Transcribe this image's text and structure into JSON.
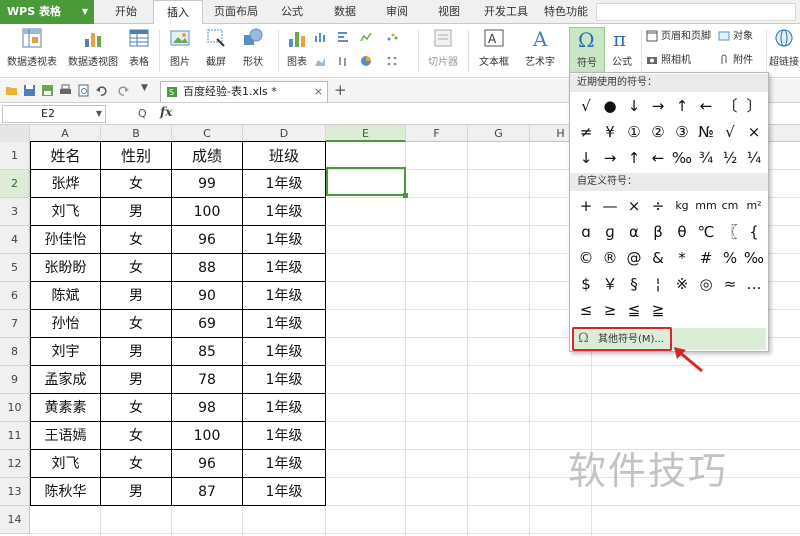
{
  "app": {
    "name": "WPS 表格"
  },
  "menu": {
    "tabs": [
      "开始",
      "插入",
      "页面布局",
      "公式",
      "数据",
      "审阅",
      "视图",
      "开发工具",
      "特色功能"
    ],
    "active": "插入"
  },
  "ribbon": {
    "pivot_table": "数据透视表",
    "pivot_chart": "数据透视图",
    "table": "表格",
    "picture": "图片",
    "screenshot": "截屏",
    "shape": "形状",
    "chart": "图表",
    "slicer": "切片器",
    "textbox": "文本框",
    "wordart": "艺术字",
    "symbol": "符号",
    "formula": "公式",
    "header_footer": "页眉和页脚",
    "object": "对象",
    "camera": "照相机",
    "attachment": "附件",
    "hyperlink": "超链接"
  },
  "document": {
    "tab_title": "百度经验-表1.xls *"
  },
  "formula_bar": {
    "cell_ref": "E2",
    "fx_label": "fx"
  },
  "sheet": {
    "columns": [
      "A",
      "B",
      "C",
      "D",
      "E",
      "F",
      "G",
      "H"
    ],
    "rows": [
      "1",
      "2",
      "3",
      "4",
      "5",
      "6",
      "7",
      "8",
      "9",
      "10",
      "11",
      "12",
      "13",
      "14"
    ],
    "header": [
      "姓名",
      "性别",
      "成绩",
      "班级"
    ],
    "data": [
      [
        "张烨",
        "女",
        "99",
        "1年级"
      ],
      [
        "刘飞",
        "男",
        "100",
        "1年级"
      ],
      [
        "孙佳怡",
        "女",
        "96",
        "1年级"
      ],
      [
        "张盼盼",
        "女",
        "88",
        "1年级"
      ],
      [
        "陈斌",
        "男",
        "90",
        "1年级"
      ],
      [
        "孙怡",
        "女",
        "69",
        "1年级"
      ],
      [
        "刘宇",
        "男",
        "85",
        "1年级"
      ],
      [
        "孟家成",
        "男",
        "78",
        "1年级"
      ],
      [
        "黄素素",
        "女",
        "98",
        "1年级"
      ],
      [
        "王语嫣",
        "女",
        "100",
        "1年级"
      ],
      [
        "刘飞",
        "女",
        "96",
        "1年级"
      ],
      [
        "陈秋华",
        "男",
        "87",
        "1年级"
      ]
    ]
  },
  "symbol_panel": {
    "recent_title": "近期使用的符号：",
    "recent": [
      "√",
      "●",
      "↓",
      "→",
      "↑",
      "←",
      "〔",
      "〕",
      "≠",
      "¥",
      "①",
      "②",
      "③",
      "№",
      "√",
      "×",
      "↓",
      "→",
      "↑",
      "←",
      "‰",
      "¾",
      "½",
      "¼"
    ],
    "custom_title": "自定义符号：",
    "custom": [
      "+",
      "—",
      "×",
      "÷",
      "kg",
      "mm",
      "cm",
      "m²",
      "ɑ",
      "ɡ",
      "α",
      "β",
      "θ",
      "℃",
      "〖",
      "{",
      "©",
      "®",
      "@",
      "&",
      "*",
      "#",
      "%",
      "‰",
      "$",
      "￥",
      "§",
      "¦",
      "※",
      "◎",
      "≈",
      "…",
      "≤",
      "≥",
      "≦",
      "≧"
    ],
    "more": "其他符号(M)..."
  },
  "watermark": "软件技巧",
  "colors": {
    "accent": "#4b9a3a",
    "highlight": "#d9262c",
    "selected_bg": "#c9e7c5"
  }
}
